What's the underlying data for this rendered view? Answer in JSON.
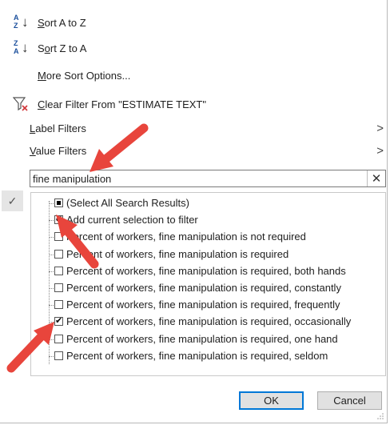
{
  "menu": {
    "sort_az": "Sort A to Z",
    "sort_za": "Sort Z to A",
    "more_sort": "More Sort Options...",
    "clear_filter": "Clear Filter From \"ESTIMATE TEXT\"",
    "label_filters": "Label Filters",
    "value_filters": "Value Filters"
  },
  "search": {
    "value": "fine manipulation",
    "clear_glyph": "✕"
  },
  "list": {
    "items": [
      {
        "label": "(Select All Search Results)",
        "state": "indeterminate"
      },
      {
        "label": "Add current selection to filter",
        "state": "checked"
      },
      {
        "label": "Percent of workers, fine manipulation is not required",
        "state": "unchecked"
      },
      {
        "label": "Percent of workers, fine manipulation is required",
        "state": "unchecked"
      },
      {
        "label": "Percent of workers, fine manipulation is required, both hands",
        "state": "unchecked"
      },
      {
        "label": "Percent of workers, fine manipulation is required, constantly",
        "state": "unchecked"
      },
      {
        "label": "Percent of workers, fine manipulation is required, frequently",
        "state": "unchecked"
      },
      {
        "label": "Percent of workers, fine manipulation is required, occasionally",
        "state": "checked"
      },
      {
        "label": "Percent of workers, fine manipulation is required, one hand",
        "state": "unchecked"
      },
      {
        "label": "Percent of workers, fine manipulation is required, seldom",
        "state": "unchecked"
      }
    ]
  },
  "buttons": {
    "ok": "OK",
    "cancel": "Cancel"
  },
  "colors": {
    "annotation_arrow": "#e8453c",
    "accent": "#0078d7"
  }
}
